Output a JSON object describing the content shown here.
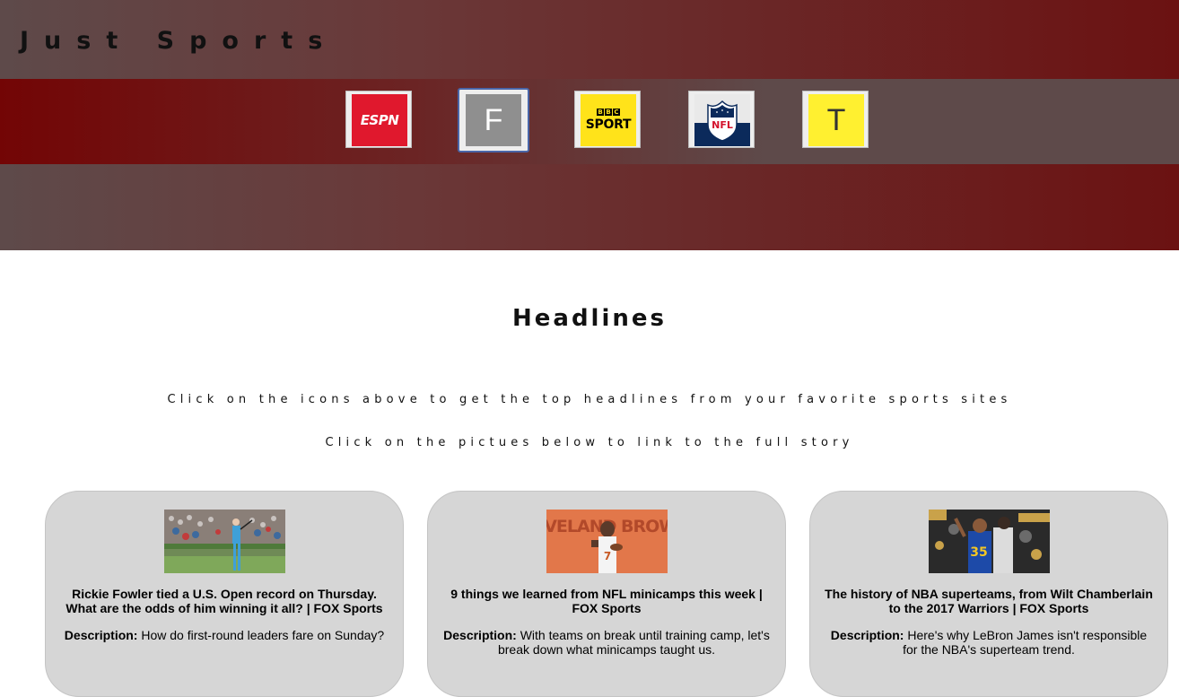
{
  "site": {
    "title": "Just Sports"
  },
  "icons": [
    {
      "name": "espn",
      "label": "ESPN",
      "bg": "#e0182d",
      "icon": "espn-logo"
    },
    {
      "name": "fox",
      "label": "F",
      "bg": "#8f8f8f",
      "icon": "letter-f-icon",
      "selected": true
    },
    {
      "name": "bbc-sport",
      "block_letters": [
        "B",
        "B",
        "C"
      ],
      "label": "SPORT",
      "bg": "#ffe31a",
      "icon": "bbc-sport-logo"
    },
    {
      "name": "nfl",
      "label": "NFL",
      "bg": "#0b2a5b",
      "icon": "nfl-shield-logo"
    },
    {
      "name": "t",
      "label": "T",
      "bg": "#fff030",
      "icon": "letter-t-icon"
    }
  ],
  "main": {
    "headline_title": "Headlines",
    "instruction_1": "Click on the icons above to get the top headlines from your favorite sports sites",
    "instruction_2": "Click on the pictues below to link to the full story"
  },
  "articles": [
    {
      "title": "Rickie Fowler tied a U.S. Open record on Thursday. What are the odds of him winning it all? | FOX Sports",
      "desc_label": "Description:",
      "desc": "How do first-round leaders fare on Sunday?",
      "image": "golfer-photo"
    },
    {
      "title": "9 things we learned from NFL minicamps this week | FOX Sports",
      "desc_label": "Description:",
      "desc": "With teams on break until training camp, let's break down what minicamps taught us.",
      "image": "cleveland-browns-player-photo",
      "image_text": "CLEVELAND BROWNS"
    },
    {
      "title": "The history of NBA superteams, from Wilt Chamberlain to the 2017 Warriors | FOX Sports",
      "desc_label": "Description:",
      "desc": "Here's why LeBron James isn't responsible for the NBA's superteam trend.",
      "image": "warriors-celebration-photo"
    }
  ],
  "colors": {
    "header_dark_red": "#6b1212",
    "header_gray": "#5e4a4a",
    "card_bg": "#d6d6d6",
    "selected_border": "#4a66a8"
  }
}
